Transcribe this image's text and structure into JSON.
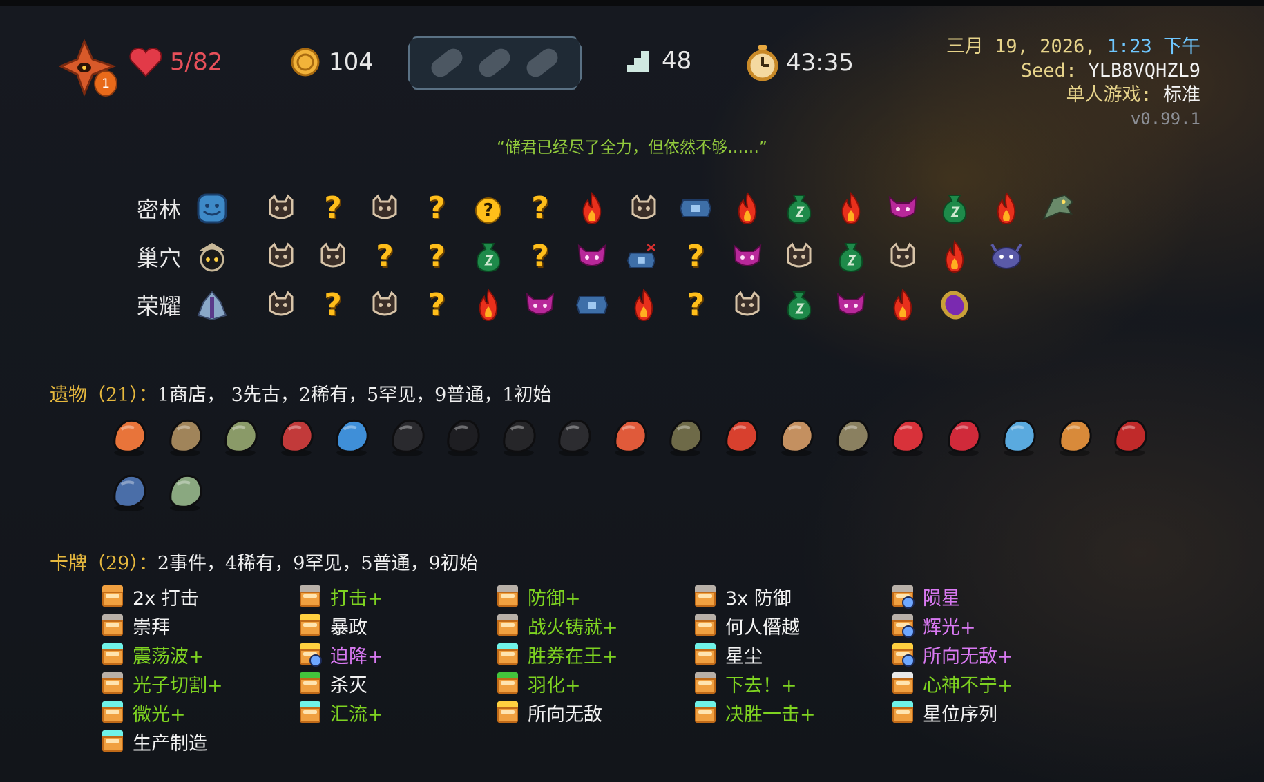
{
  "hud": {
    "ascension_level": "1",
    "hp": "5/82",
    "gold": "104",
    "floor": "48",
    "timer": "43:35",
    "icons": [
      "ascension-icon",
      "heart-icon",
      "gold-coin-icon",
      "potion-belt",
      "floor-stairs-icon",
      "stopwatch-icon"
    ],
    "potion_slots": [
      "empty-potion-slot",
      "empty-potion-slot",
      "empty-potion-slot"
    ]
  },
  "run_info": {
    "date_prefix": "三月 19, 2026, ",
    "time": "1:23 下午",
    "seed_label": "Seed: ",
    "seed": "YLB8VQHZL9",
    "mode_label": "单人游戏: ",
    "mode": "标准",
    "version": "v0.99.1"
  },
  "quote": "“储君已经尽了全力，但依然不够……”",
  "map": {
    "acts": [
      {
        "name": "密林",
        "boss": "blue-slime-boss-icon",
        "nodes": [
          "monster",
          "unknown",
          "monster",
          "unknown",
          "unknown-shop",
          "unknown",
          "rest",
          "monster",
          "treasure",
          "rest",
          "shop",
          "rest",
          "elite",
          "shop",
          "rest",
          "boss-bird"
        ]
      },
      {
        "name": "巢穴",
        "boss": "masked-boss-icon",
        "nodes": [
          "monster",
          "monster",
          "unknown",
          "unknown",
          "shop",
          "unknown",
          "elite",
          "treasure-marked",
          "unknown",
          "elite",
          "monster",
          "shop",
          "monster",
          "rest",
          "boss-bug"
        ]
      },
      {
        "name": "荣耀",
        "boss": "winged-boss-icon",
        "nodes": [
          "monster",
          "unknown",
          "monster",
          "unknown",
          "rest",
          "elite",
          "treasure",
          "rest",
          "unknown",
          "monster",
          "shop",
          "elite",
          "rest",
          "boss-gem"
        ]
      }
    ]
  },
  "relics": {
    "title": "遗物（21）：",
    "summary": "1商店， 3先古，2稀有，5罕见，9普通，1初始",
    "items": [
      {
        "name": "burning-crystal-relic",
        "color": "#e8743a"
      },
      {
        "name": "scroll-relic",
        "color": "#a0845a"
      },
      {
        "name": "frog-relic",
        "color": "#8a9a68"
      },
      {
        "name": "red-cushion-relic",
        "color": "#c23a3a"
      },
      {
        "name": "toy-box-relic",
        "color": "#3f8fd8"
      },
      {
        "name": "anchor-relic",
        "color": "#2a2a2e"
      },
      {
        "name": "black-egg-relic",
        "color": "#1e1e22"
      },
      {
        "name": "cannon-relic",
        "color": "#262629"
      },
      {
        "name": "lantern-relic",
        "color": "#2c2c30"
      },
      {
        "name": "firework-relic",
        "color": "#e05a3a"
      },
      {
        "name": "compass-relic",
        "color": "#6e6a48"
      },
      {
        "name": "nunchaku-relic",
        "color": "#d8402e"
      },
      {
        "name": "snail-shell-relic",
        "color": "#c49060"
      },
      {
        "name": "tag-relic",
        "color": "#8a8060"
      },
      {
        "name": "strawberry-relic",
        "color": "#d8323a"
      },
      {
        "name": "scarf-relic",
        "color": "#d02a3a"
      },
      {
        "name": "feather-relic",
        "color": "#5aaadf"
      },
      {
        "name": "cheese-box-relic",
        "color": "#d88a3a"
      },
      {
        "name": "potion-flask-relic",
        "color": "#c02a2a"
      },
      {
        "name": "blue-book-relic",
        "color": "#4a6ea8"
      },
      {
        "name": "newton-cradle-relic",
        "color": "#8aa880"
      }
    ]
  },
  "cards": {
    "title": "卡牌（29）：",
    "summary": "2事件，4稀有，9罕见，5普通，9初始",
    "columns": [
      [
        {
          "name": "2x 打击",
          "color": "white",
          "top": "#f0a040"
        },
        {
          "name": "崇拜",
          "color": "white",
          "top": "#b8b0a8"
        },
        {
          "name": "震荡波+",
          "color": "green",
          "top": "#6ff2e8"
        },
        {
          "name": "光子切割+",
          "color": "green",
          "top": "#b8b0a8"
        },
        {
          "name": "微光+",
          "color": "green",
          "top": "#6ff2e8"
        },
        {
          "name": "生产制造",
          "color": "white",
          "top": "#6ff2e8"
        }
      ],
      [
        {
          "name": "打击+",
          "color": "green",
          "top": "#b8b0a8"
        },
        {
          "name": "暴政",
          "color": "white",
          "top": "#ffd040"
        },
        {
          "name": "迫降+",
          "color": "purple",
          "top": "#ffd040",
          "badge": true
        },
        {
          "name": "杀灭",
          "color": "white",
          "top": "#43c43c"
        },
        {
          "name": "汇流+",
          "color": "green",
          "top": "#6ff2e8"
        }
      ],
      [
        {
          "name": "防御+",
          "color": "green",
          "top": "#b8b0a8"
        },
        {
          "name": "战火铸就+",
          "color": "green",
          "top": "#b8b0a8"
        },
        {
          "name": "胜券在王+",
          "color": "green",
          "top": "#6ff2e8"
        },
        {
          "name": "羽化+",
          "color": "green",
          "top": "#43c43c"
        },
        {
          "name": "所向无敌",
          "color": "white",
          "top": "#ffd040"
        }
      ],
      [
        {
          "name": "3x 防御",
          "color": "white",
          "top": "#b8b0a8"
        },
        {
          "name": "何人僭越",
          "color": "white",
          "top": "#b8b0a8"
        },
        {
          "name": "星尘",
          "color": "white",
          "top": "#6ff2e8"
        },
        {
          "name": "下去！+",
          "color": "green",
          "top": "#b8b0a8"
        },
        {
          "name": "决胜一击+",
          "color": "green",
          "top": "#6ff2e8"
        }
      ],
      [
        {
          "name": "陨星",
          "color": "purple",
          "top": "#b8b0a8",
          "badge": true
        },
        {
          "name": "辉光+",
          "color": "purple",
          "top": "#b8b0a8",
          "badge": true
        },
        {
          "name": "所向无敌+",
          "color": "purple",
          "top": "#ffd040",
          "badge": true
        },
        {
          "name": "心神不宁+",
          "color": "green",
          "top": "#e8e8e8"
        },
        {
          "name": "星位序列",
          "color": "white",
          "top": "#6ff2e8"
        }
      ]
    ]
  }
}
